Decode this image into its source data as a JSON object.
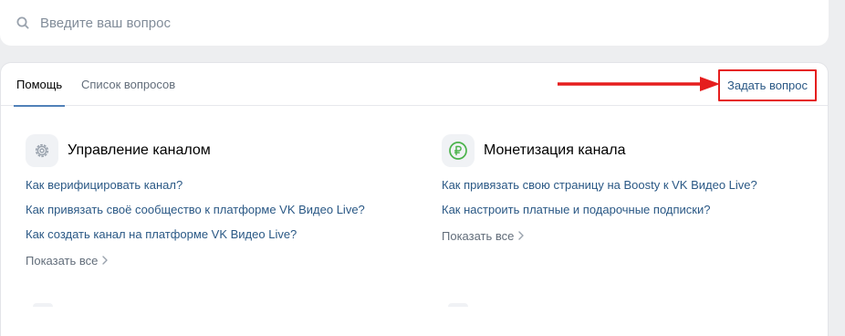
{
  "search": {
    "placeholder": "Введите ваш вопрос"
  },
  "tabs": [
    {
      "label": "Помощь",
      "active": true
    },
    {
      "label": "Список вопросов",
      "active": false
    }
  ],
  "ask_button": {
    "label": "Задать вопрос"
  },
  "sections": [
    {
      "title": "Управление каналом",
      "icon": "gear-icon",
      "links": [
        "Как верифицировать канал?",
        "Как привязать своё сообщество к платформе VK Видео Live?",
        "Как создать канал на платформе VK Видео Live?"
      ],
      "show_all": "Показать все"
    },
    {
      "title": "Монетизация канала",
      "icon": "ruble-icon",
      "links": [
        "Как привязать свою страницу на Boosty к VK Видео Live?",
        "Как настроить платные и подарочные подписки?"
      ],
      "show_all": "Показать все"
    }
  ],
  "colors": {
    "link": "#2a5885",
    "accent": "#5181b8",
    "highlight": "#e51e1e",
    "monetization_icon": "#4bb34b"
  }
}
